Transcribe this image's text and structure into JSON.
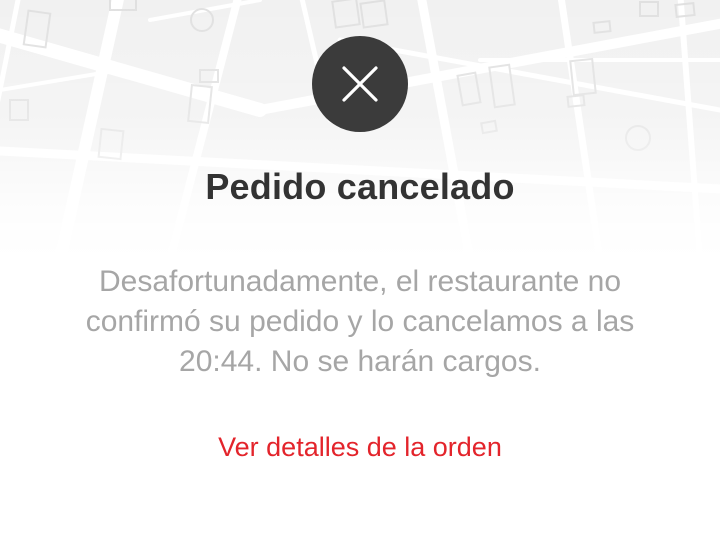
{
  "screen": {
    "title": "Pedido cancelado",
    "message": "Desafortunadamente, el restaurante no confirmó su pedido y lo cancelamos a las 20:44. No se harán cargos.",
    "details_link": "Ver detalles de la orden"
  },
  "icons": {
    "status": "close-icon",
    "background": "map-background"
  },
  "colors": {
    "icon_circle": "#3b3b3b",
    "title": "#333333",
    "message": "#a6a6a6",
    "link": "#e3242b"
  }
}
